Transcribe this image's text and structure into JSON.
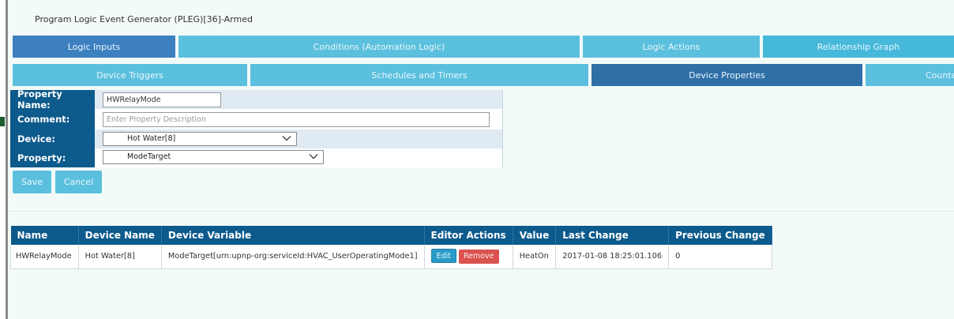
{
  "title": "Program Logic Event Generator (PLEG)[36]-Armed",
  "main_tabs": [
    {
      "label": "Logic Inputs"
    },
    {
      "label": "Conditions (Automation Logic)"
    },
    {
      "label": "Logic Actions"
    },
    {
      "label": "Relationship Graph"
    }
  ],
  "sub_tabs": [
    {
      "label": "Device Triggers"
    },
    {
      "label": "Schedules and Timers"
    },
    {
      "label": "Device Properties"
    },
    {
      "label": "Counter"
    }
  ],
  "form": {
    "property_name_label": "Property Name:",
    "property_name_value": "HWRelayMode",
    "comment_label": "Comment:",
    "comment_placeholder": "Enter Property Description",
    "device_label": "Device:",
    "device_value": "Hot Water[8]",
    "property_label": "Property:",
    "property_value": "ModeTarget"
  },
  "buttons": {
    "save": "Save",
    "cancel": "Cancel"
  },
  "table": {
    "headers": [
      "Name",
      "Device Name",
      "Device Variable",
      "Editor Actions",
      "Value",
      "Last Change",
      "Previous Change"
    ],
    "rows": [
      {
        "name": "HWRelayMode",
        "device_name": "Hot Water[8]",
        "device_variable": "ModeTarget[urn:upnp-org:serviceId:HVAC_UserOperatingMode1]",
        "edit_label": "Edit",
        "remove_label": "Remove",
        "value": "HeatOn",
        "last_change": "2017-01-08 18:25:01.106",
        "previous_change": "0"
      }
    ]
  },
  "colors": {
    "tab_dark": "#3d80c0",
    "tab_light": "#5bc0de",
    "tab_active": "#2f6fa7",
    "header_navy": "#0d5a8c",
    "remove_red": "#d9534f",
    "panel_bg": "#f3fbf8"
  }
}
